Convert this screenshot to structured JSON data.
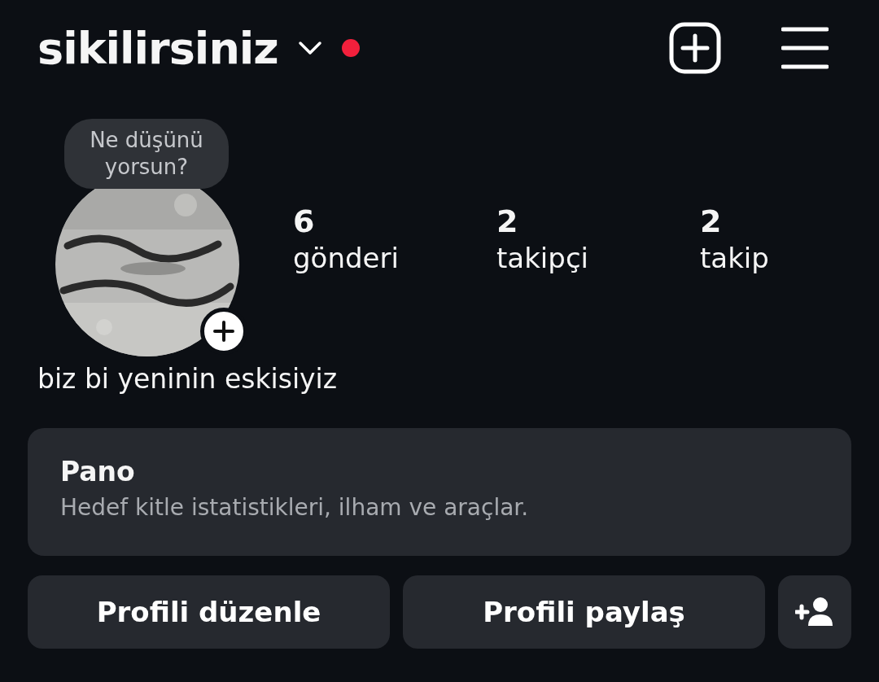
{
  "header": {
    "username": "sikilirsiniz",
    "notification_dot": true
  },
  "profile": {
    "note": "Ne düşünü yorsun?",
    "stats": [
      {
        "count": "6",
        "label": "gönderi"
      },
      {
        "count": "2",
        "label": "takipçi"
      },
      {
        "count": "2",
        "label": "takip"
      }
    ],
    "bio": "biz bi yeninin eskisiyiz"
  },
  "dashboard": {
    "title": "Pano",
    "subtitle": "Hedef kitle istatistikleri, ilham ve araçlar."
  },
  "buttons": [
    "Profili düzenle",
    "Profili paylaş"
  ]
}
